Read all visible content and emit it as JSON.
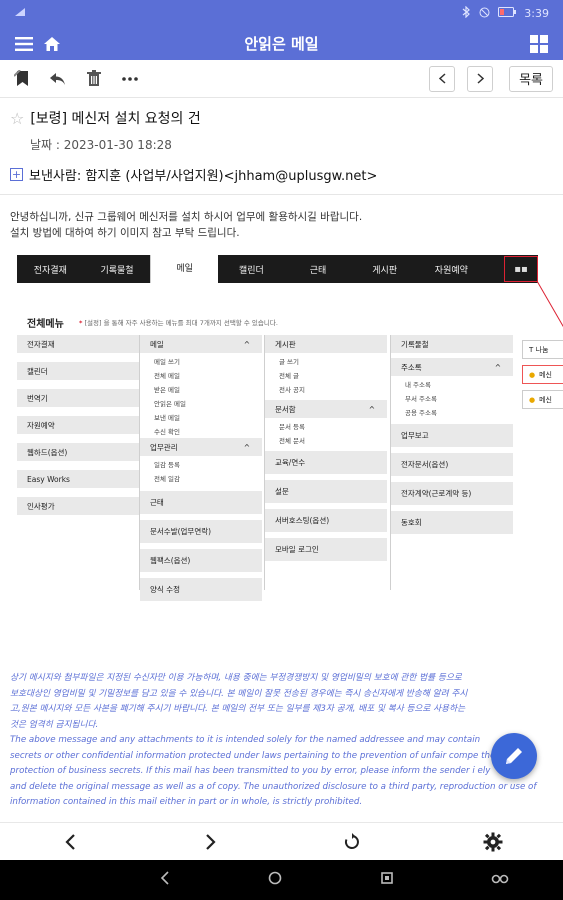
{
  "status_bar": {
    "left_icon": "signal-icon",
    "time": "3:39"
  },
  "app_bar": {
    "title": "안읽은 메일"
  },
  "toolbar": {
    "list_label": "목록"
  },
  "mail": {
    "subject": "[보령] 메신저 설치 요청의 건",
    "date": "날짜 : 2023-01-30 18:28",
    "sender": "보낸사람: 함지훈 (사업부/사업지원)<jhham@uplusgw.net>",
    "body_lines": [
      "안녕하십니까, 신규 그룹웨어 메신저를 설치 하시어 업무에 활용하시길 바랍니다.",
      "설치 방법에 대하여 하기 이미지 참고 부탁 드립니다."
    ]
  },
  "embedded": {
    "menu": [
      "전자결재",
      "기록물철",
      "메일",
      "캘린더",
      "근태",
      "게시판",
      "자원예약"
    ],
    "all_menu_title": "전체메뉴",
    "all_menu_note_star": "*",
    "all_menu_note": "[설정] 을 통해 자주 사용하는 메뉴를 최대 7개까지 선택할 수 있습니다.",
    "col1": [
      "전자결재",
      "캘린더",
      "번역기",
      "자원예약",
      "웹하드(옵션)",
      "Easy Works",
      "인사평가"
    ],
    "col2": {
      "mail_head": "메일",
      "mail_items": [
        "메일 쓰기",
        "전체 메일",
        "받은 메일",
        "안읽은 메일",
        "보낸 메일",
        "수신 확인"
      ],
      "work_head": "업무관리",
      "work_items": [
        "일감 등록",
        "전체 일감"
      ],
      "rest": [
        "근태",
        "문서수발(업무연락)",
        "웹팩스(옵션)",
        "양식 수정"
      ]
    },
    "col3": {
      "board_head": "게시판",
      "board_items": [
        "글 쓰기",
        "전체 글",
        "전사 공지"
      ],
      "doc_head": "문서함",
      "doc_items": [
        "문서 등록",
        "전체 문서"
      ],
      "rest": [
        "교육/연수",
        "설문",
        "서버호스팅(옵션)",
        "모바일 로그인"
      ]
    },
    "col4": {
      "head": "기록물철",
      "addr_head": "주소록",
      "addr_items": [
        "내 주소록",
        "부서 주소록",
        "공용 주소록"
      ],
      "rest": [
        "업무보고",
        "전자문서(옵션)",
        "전자계약(근로계약 등)",
        "동호회"
      ]
    },
    "side": [
      "T 나눔",
      "메신",
      "메신"
    ]
  },
  "disclaimer": [
    "상기 메시지와 첨부파일은 지정된 수신자만 이용 가능하며, 내용 중에는 부정경쟁방지 및 영업비밀의 보호에 관한 법률 등으로",
    "보호대상인 영업비밀 및 기밀정보를 담고 있을 수 있습니다. 본 메일이 잘못 전송된 경우에는 즉시 송신자에게 반송해 알려 주시",
    "고,원본 메시지와 모든 사본을 폐기해 주시기 바랍니다. 본 메일의 전부 또는 일부를 제3자 공개, 배포 및 복사 등으로 사용하는",
    "것은 엄격히 금지됩니다.",
    "The above message and any attachments to it is intended solely for the named addressee and may contain",
    "secrets or other confidential information protected under laws pertaining to the prevention of unfair compe the",
    "protection of business secrets. If this mail has been transmitted to you by error, please inform the sender i ely",
    "and delete the original message as well as a of copy. The unauthorized disclosure to a third party, reproduction or use of",
    "information contained in this mail either in part or in whole, is strictly prohibited."
  ],
  "colors": {
    "primary": "#5b6fd6",
    "fab": "#3c68d8",
    "disclaimer": "#5b6fd6"
  }
}
